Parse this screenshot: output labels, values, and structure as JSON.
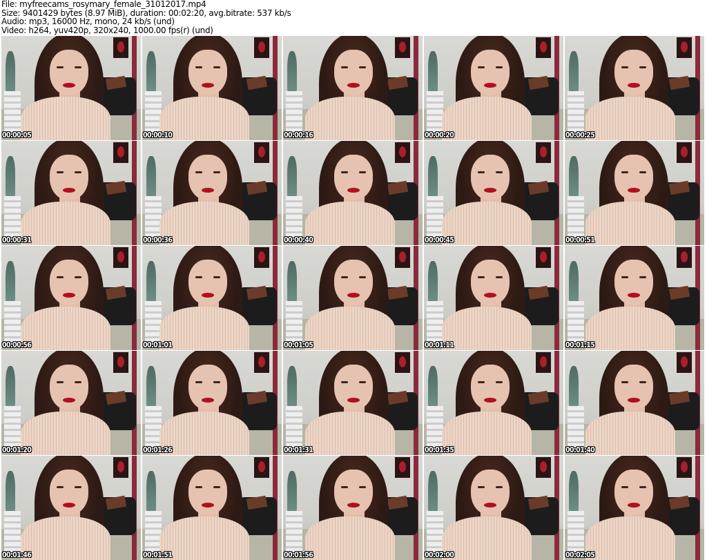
{
  "header": {
    "file": "File: myfreecams_rosymary_female_31012017.mp4",
    "size": "Size: 9401429 bytes (8.97 MiB), duration: 00:02:20, avg.bitrate: 537 kb/s",
    "audio": "Audio: mp3, 16000 Hz, mono, 24 kb/s (und)",
    "video": "Video: h264, yuv420p, 320x240, 1000.00 fps(r) (und)"
  },
  "thumbnails": [
    "00:00:05",
    "00:00:10",
    "00:00:16",
    "00:00:20",
    "00:00:25",
    "00:00:31",
    "00:00:36",
    "00:00:40",
    "00:00:45",
    "00:00:51",
    "00:00:56",
    "00:01:01",
    "00:01:05",
    "00:01:11",
    "00:01:15",
    "00:01:20",
    "00:01:26",
    "00:01:31",
    "00:01:35",
    "00:01:40",
    "00:01:46",
    "00:01:51",
    "00:01:56",
    "00:02:00",
    "00:02:05"
  ]
}
